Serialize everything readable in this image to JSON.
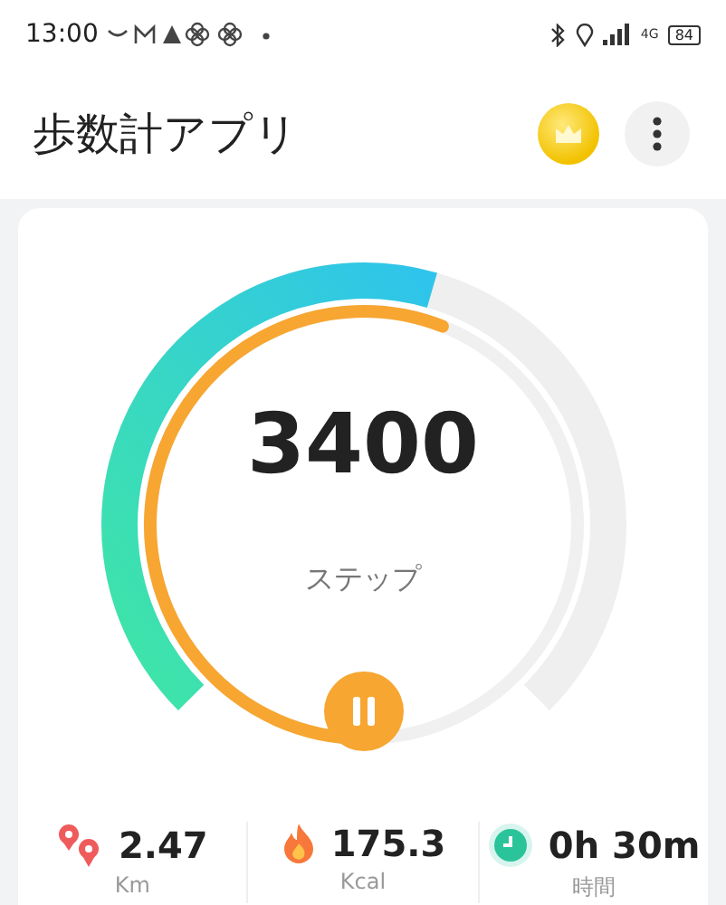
{
  "status_bar": {
    "time": "13:00",
    "network": "4G",
    "battery": "84"
  },
  "header": {
    "title": "歩数計アプリ"
  },
  "gauge": {
    "steps": "3400",
    "label": "ステップ",
    "running": true
  },
  "stats": [
    {
      "kind": "distance",
      "value": "2.47",
      "unit": "Km"
    },
    {
      "kind": "calories",
      "value": "175.3",
      "unit": "Kcal"
    },
    {
      "kind": "time",
      "value": "0h 30m",
      "unit": "時間"
    }
  ]
}
